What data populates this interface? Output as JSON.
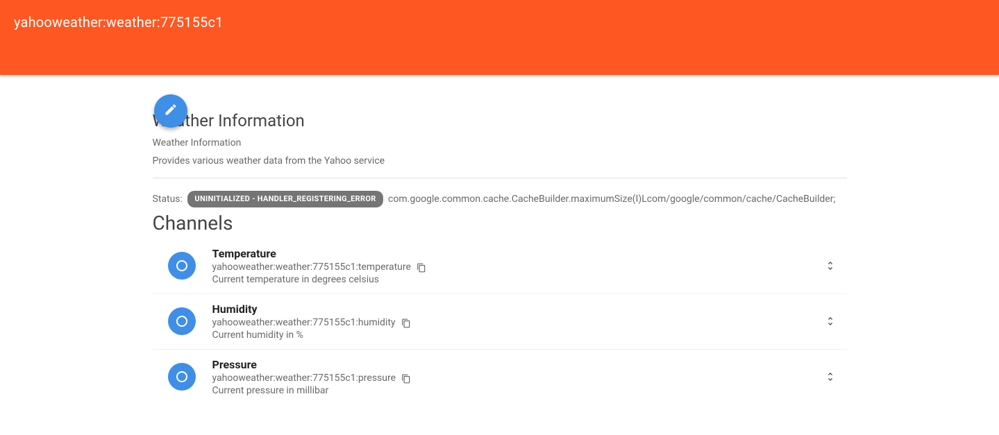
{
  "header": {
    "title": "yahooweather:weather:775155c1"
  },
  "thing": {
    "title": "Weather Information",
    "subtitle": "Weather Information",
    "description": "Provides various weather data from the Yahoo service",
    "status_label": "Status:",
    "status_badge": "UNINITIALIZED - HANDLER_REGISTERING_ERROR",
    "status_message": "com.google.common.cache.CacheBuilder.maximumSize(I)Lcom/google/common/cache/CacheBuilder;"
  },
  "channels_title": "Channels",
  "channels": [
    {
      "name": "Temperature",
      "id": "yahooweather:weather:775155c1:temperature",
      "description": "Current temperature in degrees celsius"
    },
    {
      "name": "Humidity",
      "id": "yahooweather:weather:775155c1:humidity",
      "description": "Current humidity in %"
    },
    {
      "name": "Pressure",
      "id": "yahooweather:weather:775155c1:pressure",
      "description": "Current pressure in millibar"
    }
  ]
}
